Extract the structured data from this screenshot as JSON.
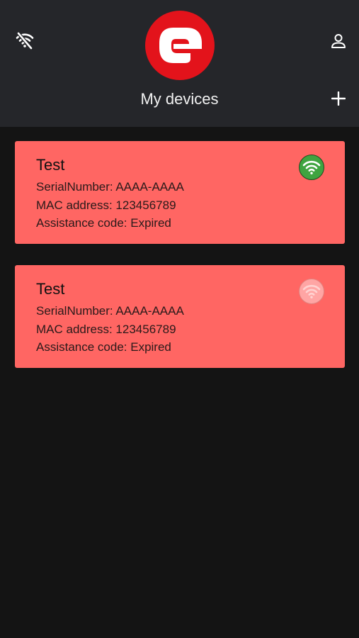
{
  "header": {
    "title": "My devices",
    "logo_icon": "e-logo-icon",
    "left_icon": "wifi-off-icon",
    "right_icon": "user-icon",
    "add_icon": "plus-icon",
    "colors": {
      "header_bg": "#25262a",
      "logo_red": "#e3131b"
    }
  },
  "devices": [
    {
      "name": "Test",
      "serial": "SerialNumber: AAAA-AAAA",
      "mac": "MAC address: 123456789",
      "assistance": "Assistance code: Expired",
      "status_icon": "wifi-icon",
      "status": "online",
      "status_color": "#3fa440"
    },
    {
      "name": "Test",
      "serial": "SerialNumber: AAAA-AAAA",
      "mac": "MAC address: 123456789",
      "assistance": "Assistance code: Expired",
      "status_icon": "wifi-icon",
      "status": "offline",
      "status_color": "#ffa5a4"
    }
  ],
  "colors": {
    "card_bg": "#ff6663",
    "page_bg": "#141414"
  }
}
